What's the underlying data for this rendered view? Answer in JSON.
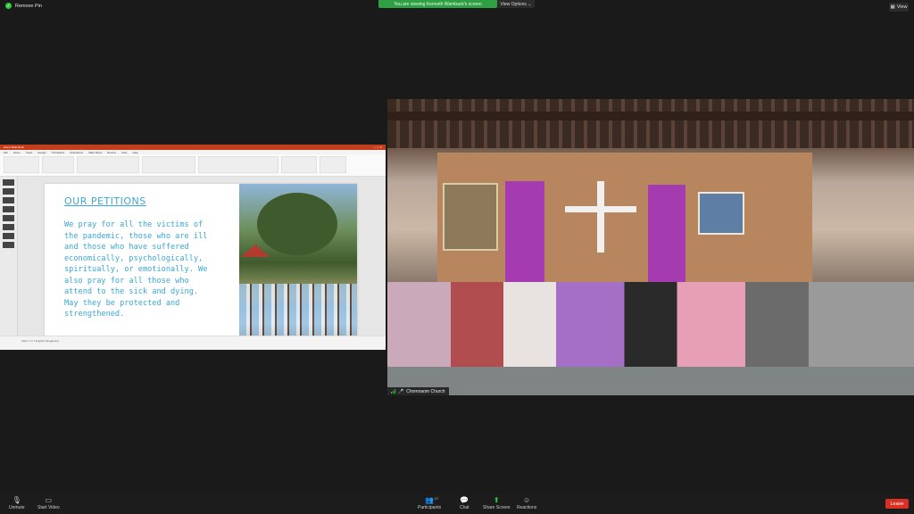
{
  "top": {
    "pin_label": "Remove Pin",
    "share_banner": "You are viewing Kenneth Wamback's screen",
    "view_options": "View Options ⌄",
    "view_label": "View"
  },
  "shared_screen": {
    "ppt_title": "Zoom Slide Deck",
    "menu": [
      "File",
      "Home",
      "Insert",
      "Design",
      "Transitions",
      "Animations",
      "Slide Show",
      "Review",
      "View",
      "Help"
    ],
    "slide": {
      "heading": "OUR PETITIONS",
      "body": "We pray for all the victims of the pandemic, those who are ill and those who have suffered economically, psychologically, spiritually, or emotionally. We also pray for all those who attend to the sick and dying. May they be protected and strengthened."
    },
    "status_text": "Slide 1 of 1   English (Singapore)"
  },
  "video_tile": {
    "participant_name": "Chomnaom Church"
  },
  "toolbar": {
    "unmute": "Unmute",
    "start_video": "Start Video",
    "participants": "Participants",
    "participants_count": "57",
    "chat": "Chat",
    "share_screen": "Share Screen",
    "reactions": "Reactions",
    "leave": "Leave"
  },
  "colors": {
    "share_banner": "#2ea043",
    "leave": "#d93025",
    "slide_text": "#3aa7d6"
  }
}
